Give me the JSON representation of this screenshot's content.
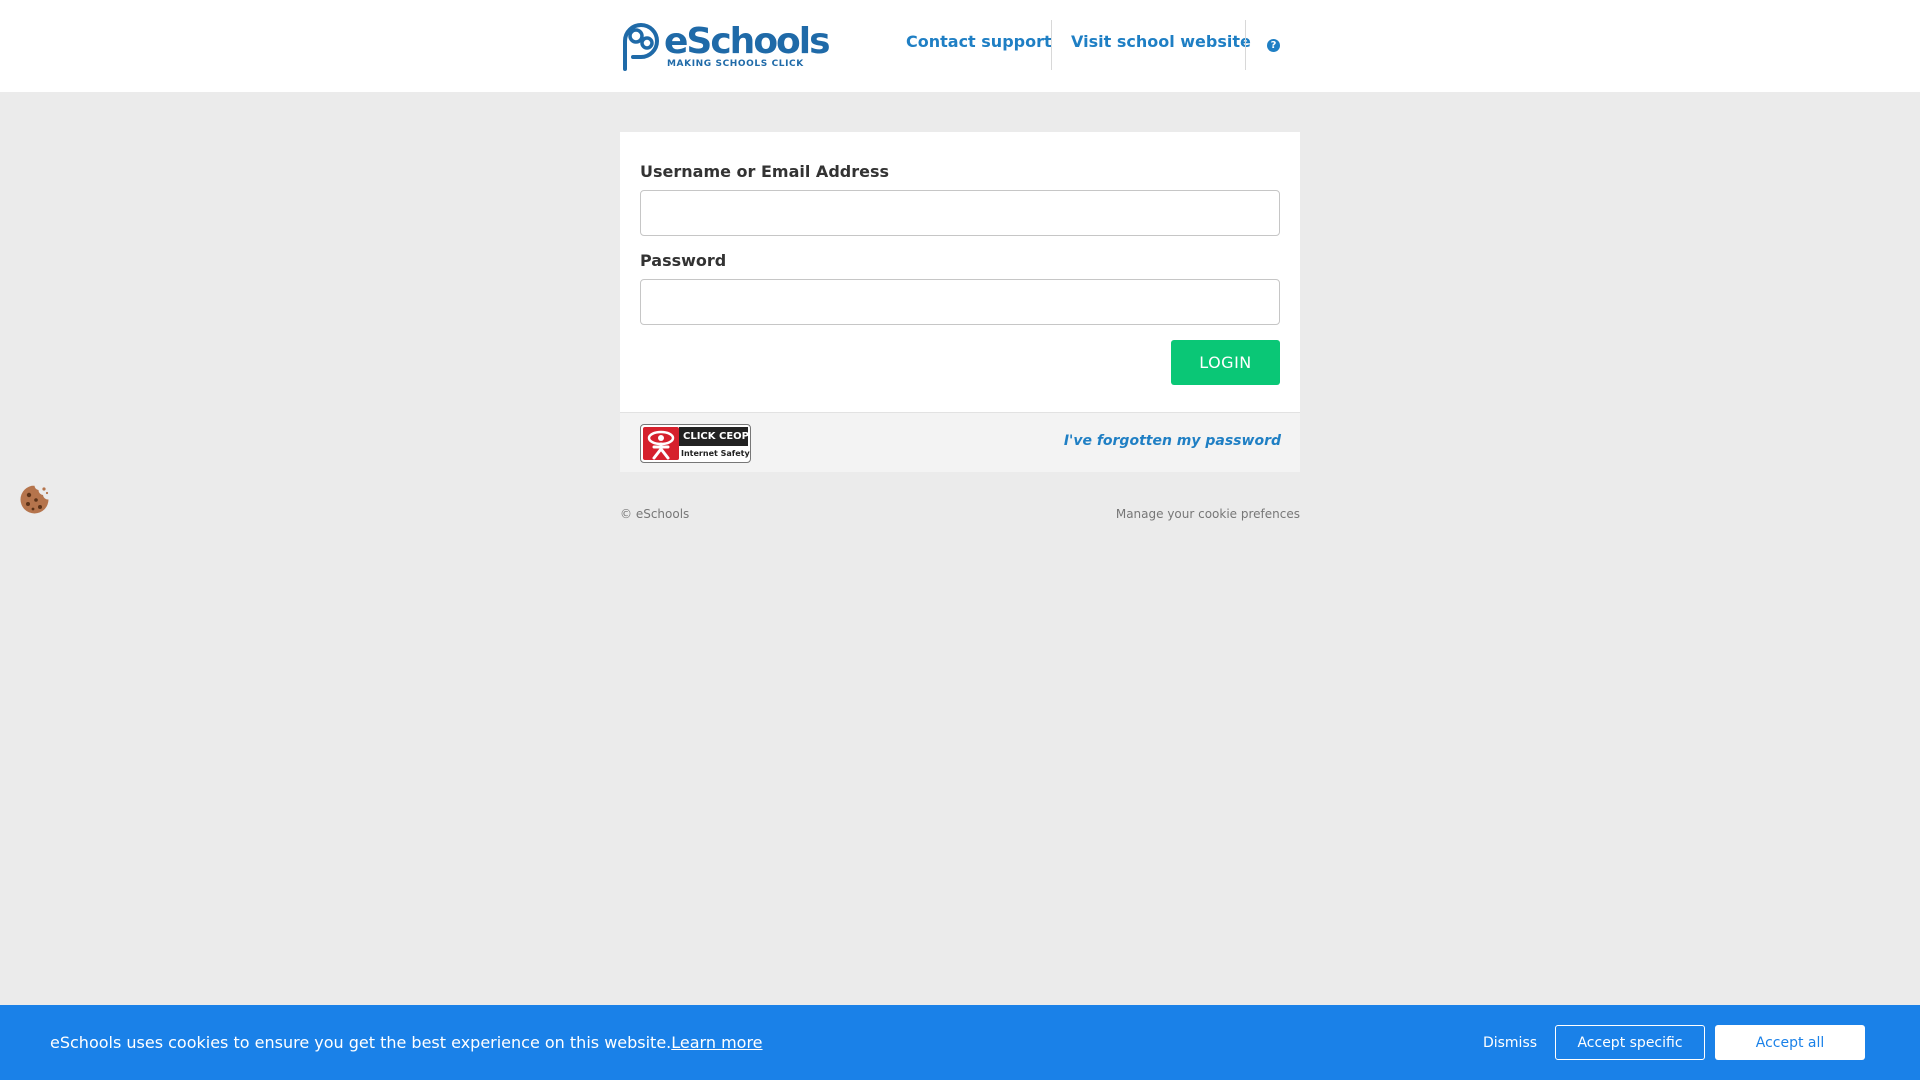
{
  "header": {
    "logo": {
      "wordmark": "eSchools",
      "tagline": "MAKING SCHOOLS CLICK"
    },
    "nav": {
      "contact_support": "Contact support",
      "visit_school": "Visit school website",
      "help_icon": "question-circle-icon",
      "help_glyph": "?"
    }
  },
  "login_form": {
    "username_label": "Username or Email Address",
    "username_value": "",
    "password_label": "Password",
    "password_value": "",
    "login_button": "LOGIN",
    "ceop_badge": {
      "top_text": "CLICK CEOP",
      "bottom_text": "Internet Safety"
    },
    "forgot_password": "I've forgotten my password"
  },
  "footer": {
    "copyright": "© eSchools",
    "manage_cookies": "Manage your cookie prefences"
  },
  "cookie_banner": {
    "message": "eSchools uses cookies to ensure you get the best experience on this website.",
    "learn_more": "Learn more",
    "dismiss": "Dismiss",
    "accept_specific": "Accept specific",
    "accept_all": "Accept all"
  },
  "colors": {
    "brand_blue": "#1f6aa8",
    "link_blue": "#1f7fc4",
    "login_green": "#0ac776",
    "banner_blue": "#1a81e8",
    "page_bg": "#ebebeb"
  }
}
